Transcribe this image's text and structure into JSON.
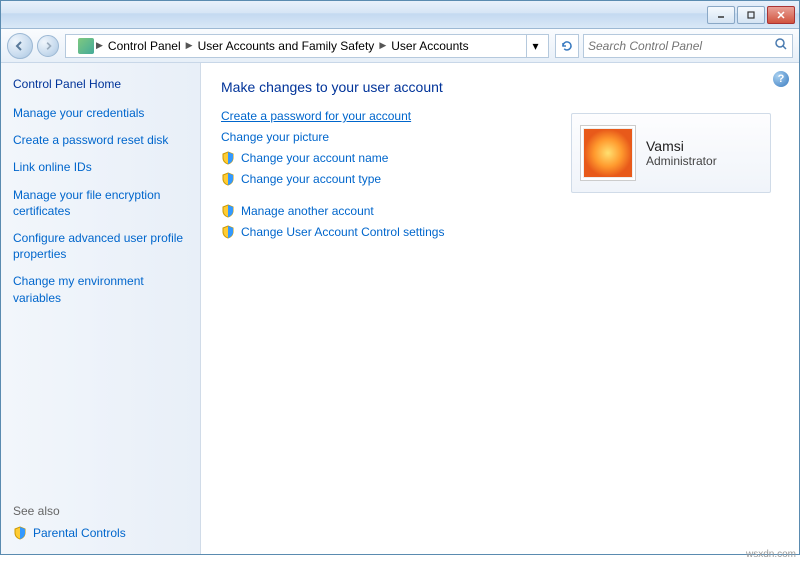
{
  "titlebar": {
    "min": "–",
    "max": "▢",
    "close": "✕"
  },
  "breadcrumb": {
    "items": [
      "Control Panel",
      "User Accounts and Family Safety",
      "User Accounts"
    ]
  },
  "search": {
    "placeholder": "Search Control Panel"
  },
  "sidebar": {
    "home": "Control Panel Home",
    "links": [
      "Manage your credentials",
      "Create a password reset disk",
      "Link online IDs",
      "Manage your file encryption certificates",
      "Configure advanced user profile properties",
      "Change my environment variables"
    ],
    "see_also": "See also",
    "parental": "Parental Controls"
  },
  "content": {
    "heading": "Make changes to your user account",
    "group1": [
      {
        "label": "Create a password for your account",
        "shield": false,
        "underline": true
      },
      {
        "label": "Change your picture",
        "shield": false,
        "underline": false
      },
      {
        "label": "Change your account name",
        "shield": true,
        "underline": false
      },
      {
        "label": "Change your account type",
        "shield": true,
        "underline": false
      }
    ],
    "group2": [
      {
        "label": "Manage another account",
        "shield": true
      },
      {
        "label": "Change User Account Control settings",
        "shield": true
      }
    ]
  },
  "user": {
    "name": "Vamsi",
    "role": "Administrator"
  },
  "watermark": "wsxdn.com"
}
